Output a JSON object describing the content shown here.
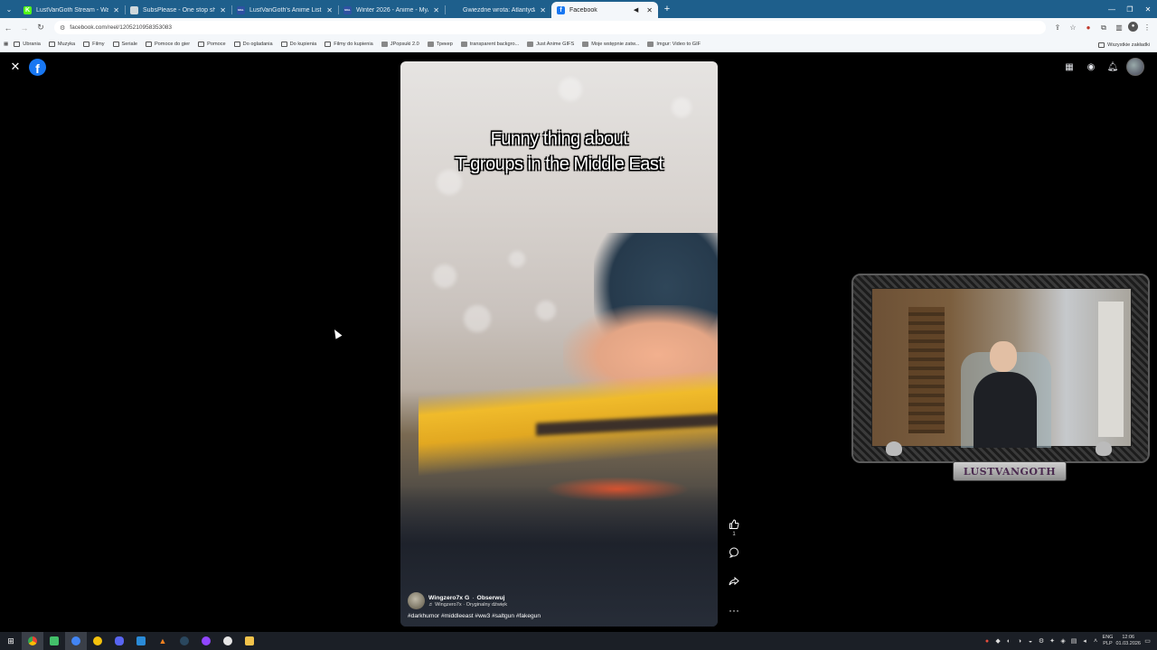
{
  "browser": {
    "tabs": [
      {
        "title": "LustVanGoth Stream - Watch Li",
        "favicon_color": "#53fc18",
        "favicon_glyph": "K"
      },
      {
        "title": "SubsPlease - One stop shop fo",
        "favicon_color": "#cfd8dc",
        "favicon_glyph": ""
      },
      {
        "title": "LustVanGoth's Anime List - My",
        "favicon_color": "#2e51a2",
        "favicon_glyph": "MAL"
      },
      {
        "title": "Winter 2026 - Anime - MyAnim",
        "favicon_color": "#2e51a2",
        "favicon_glyph": "MAL"
      },
      {
        "title": "Gwiezdne wrota: Atlantyda / St",
        "favicon_color": "#1e5f8c",
        "favicon_glyph": ""
      },
      {
        "title": "Facebook",
        "favicon_color": "#1877f2",
        "favicon_glyph": "f",
        "active": true
      }
    ],
    "address": "facebook.com/reel/1205210958353083",
    "bookmarks": [
      {
        "label": "Ubrania",
        "type": "folder"
      },
      {
        "label": "Muzyka",
        "type": "folder"
      },
      {
        "label": "Filmy",
        "type": "folder"
      },
      {
        "label": "Seriale",
        "type": "folder"
      },
      {
        "label": "Pomoce do gier",
        "type": "folder"
      },
      {
        "label": "Pomoce",
        "type": "folder"
      },
      {
        "label": "Do ogladania",
        "type": "folder"
      },
      {
        "label": "Do kupienia",
        "type": "folder"
      },
      {
        "label": "Filmy do kupienia",
        "type": "folder"
      },
      {
        "label": "JPopsuki 2.0",
        "type": "site"
      },
      {
        "label": "Трекер",
        "type": "site"
      },
      {
        "label": "transparent backgro...",
        "type": "site"
      },
      {
        "label": "Just Anime GIFS",
        "type": "site"
      },
      {
        "label": "Moje wstępnie zatw...",
        "type": "site"
      },
      {
        "label": "Imgur: Video to GIF",
        "type": "site"
      }
    ],
    "bookmarks_other": "Wszystkie zakładki"
  },
  "reel": {
    "caption_line1": "Funny thing about",
    "caption_line2": "T-groups in the Middle East",
    "author": "Wingzero7x G",
    "separator": "·",
    "follow": "Obserwuj",
    "audio": "♬ Wingzero7x · Oryginalny dźwięk",
    "hashtags": "#darkhumor #middleeast #ww3 #saltgun #fakegun",
    "like_count": "1"
  },
  "stream_overlay": {
    "name_plate": "LUSTVANGOTH"
  },
  "taskbar": {
    "language_top": "ENG",
    "language_bottom": "PLP",
    "time": "12:06",
    "date": "01.03.2026"
  },
  "icons": {
    "close": "close-icon",
    "facebook": "facebook-logo-icon",
    "menu": "grid-menu-icon",
    "messenger": "messenger-icon",
    "notifications": "bell-icon",
    "like": "thumbs-up-icon",
    "comment": "comment-icon",
    "share": "share-icon",
    "more": "more-icon"
  },
  "colors": {
    "tabstrip": "#1e5f8c",
    "facebook_blue": "#1877f2",
    "page_background": "#000000"
  }
}
